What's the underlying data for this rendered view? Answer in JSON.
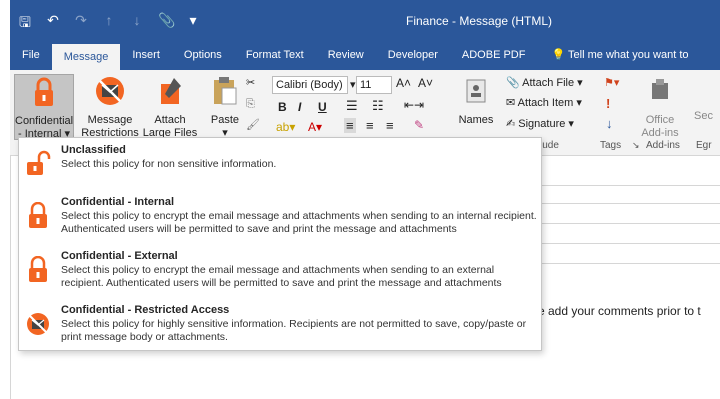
{
  "window": {
    "title": "Finance - Message (HTML)"
  },
  "qat": {
    "save": "🖫",
    "undo": "↶",
    "redo": "↷",
    "up": "↑",
    "down": "↓",
    "attach": "📎",
    "more": "▾"
  },
  "tabs": [
    {
      "label": "File"
    },
    {
      "label": "Message",
      "active": true
    },
    {
      "label": "Insert"
    },
    {
      "label": "Options"
    },
    {
      "label": "Format Text"
    },
    {
      "label": "Review"
    },
    {
      "label": "Developer"
    },
    {
      "label": "ADOBE PDF"
    }
  ],
  "tell_me": "Tell me what you want to",
  "ribbon": {
    "confidential": {
      "line1": "Confidential",
      "line2": "- Internal ▾"
    },
    "restrictions": {
      "line1": "Message",
      "line2": "Restrictions"
    },
    "attach_large": {
      "line1": "Attach",
      "line2": "Large Files"
    },
    "paste": {
      "line1": "Paste",
      "line2": "▾"
    },
    "font_name": "Calibri (Body)",
    "font_size": "11",
    "bold": "B",
    "italic": "I",
    "underline": "U",
    "names": "Names",
    "attach_file": "Attach File ▾",
    "attach_item": "Attach Item ▾",
    "signature": "Signature ▾",
    "include_label": "lude",
    "tags_label": "Tags",
    "office_addins": {
      "line1": "Office",
      "line2": "Add-ins"
    },
    "addins_label": "Add-ins",
    "egr_label": "Egr",
    "sec_label": "Sec"
  },
  "body_text": "e add your comments prior to t",
  "menu": {
    "items": [
      {
        "title": "Unclassified",
        "desc": "Select this policy for non sensitive information.",
        "icon": "open-lock-icon"
      },
      {
        "title": "Confidential - Internal",
        "desc": "Select this policy to encrypt the email message and attachments when sending to an internal recipient. Authenticated users will be permitted to save and print the message and attachments",
        "icon": "lock-icon"
      },
      {
        "title": "Confidential - External",
        "desc": "Select this policy to encrypt the email message and attachments when sending to an external recipient. Authenticated users will be permitted to save and print the message and attachments",
        "icon": "lock-icon"
      },
      {
        "title": "Confidential - Restricted Access",
        "desc": "Select this policy for highly sensitive information. Recipients are not permitted to save, copy/paste or print message body or attachments.",
        "icon": "restricted-envelope-icon"
      }
    ]
  },
  "colors": {
    "accent": "#2b579a",
    "lock": "#f26522",
    "ribbon": "#f3f3f3"
  }
}
